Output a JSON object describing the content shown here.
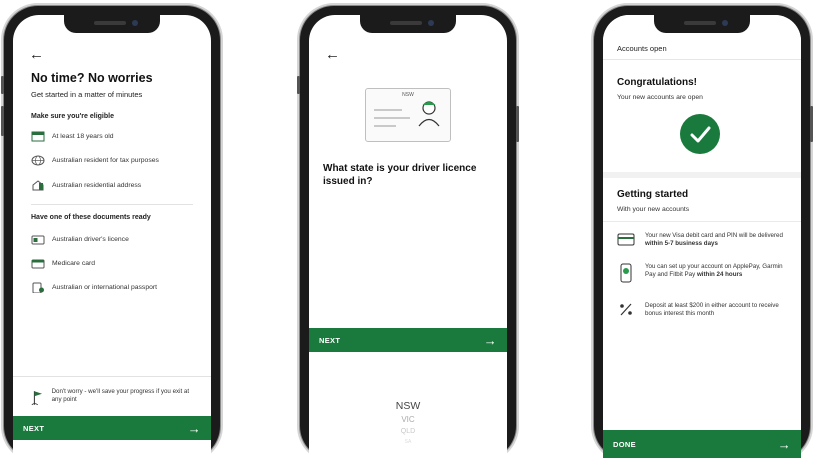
{
  "screen1": {
    "title": "No time? No worries",
    "subtitle": "Get started in a matter of minutes",
    "eligibility_heading": "Make sure you're eligible",
    "eligibility": [
      {
        "icon": "calendar-icon",
        "label": "At least 18 years old"
      },
      {
        "icon": "globe-icon",
        "label": "Australian resident for tax purposes"
      },
      {
        "icon": "house-icon",
        "label": "Australian residential address"
      }
    ],
    "documents_heading": "Have one of these documents ready",
    "documents": [
      {
        "icon": "license-icon",
        "label": "Australian driver's licence"
      },
      {
        "icon": "medicare-card-icon",
        "label": "Medicare card"
      },
      {
        "icon": "passport-icon",
        "label": "Australian or international passport"
      }
    ],
    "note": "Don't worry - we'll save your progress if you exit at any point",
    "next_label": "NEXT"
  },
  "screen2": {
    "card_state": "NSW",
    "question": "What state is your driver licence issued in?",
    "next_label": "NEXT",
    "picker": [
      "NSW",
      "VIC",
      "QLD",
      "SA"
    ],
    "picker_selected": "NSW"
  },
  "screen3": {
    "header": "Accounts open",
    "title": "Congratulations!",
    "subtitle": "Your new accounts are open",
    "section_title": "Getting started",
    "section_subtitle": "With your new accounts",
    "items": [
      {
        "icon": "card-icon",
        "text": "Your new Visa debit card and PIN will be delivered",
        "bold": "within 5-7 business days"
      },
      {
        "icon": "phone-icon",
        "text": "You can set up your account on ApplePay, Garmin Pay and Fitbit Pay",
        "bold": "within 24 hours"
      },
      {
        "icon": "percent-icon",
        "text": "Deposit at least $200 in either account to receive bonus interest this month",
        "bold": ""
      }
    ],
    "done_label": "DONE"
  },
  "colors": {
    "brand_green": "#1a7a3d",
    "frame": "#1b1b1b"
  }
}
